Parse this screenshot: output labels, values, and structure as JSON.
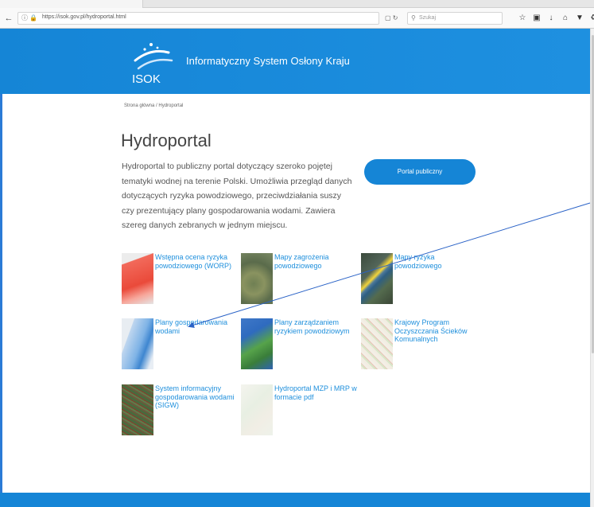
{
  "browser": {
    "url": "https://isok.gov.pl/hydroportal.html",
    "search_placeholder": "Szukaj"
  },
  "header": {
    "logo_text": "ISOK",
    "site_name": "Informatyczny System Osłony Kraju"
  },
  "breadcrumb": {
    "home": "Strona główna",
    "separator": " / ",
    "current": "Hydroportal"
  },
  "page": {
    "title": "Hydroportal",
    "description": "Hydroportal to publiczny portal dotyczący szeroko pojętej tematyki wodnej na terenie Polski. Umożliwia przegląd danych dotyczących ryzyka powodziowego, przeciwdziałania suszy czy prezentujący plany gospodarowania wodami. Zawiera szereg danych zebranych w jednym miejscu.",
    "portal_button": "Portal publiczny"
  },
  "tiles": [
    {
      "label": "Wstępna ocena ryzyka powodziowego (WORP)",
      "thumb": "flood-risk-map-thumbnail"
    },
    {
      "label": "Mapy zagrożenia powodziowego",
      "thumb": "flood-hazard-map-thumbnail"
    },
    {
      "label": "Mapy ryzyka powodziowego",
      "thumb": "flood-risk-aerial-thumbnail"
    },
    {
      "label": "Plany gospodarowania wodami",
      "thumb": "water-management-map-thumbnail"
    },
    {
      "label": "Plany zarządzaniem ryzykiem powodziowym",
      "thumb": "flood-management-map-thumbnail"
    },
    {
      "label": "Krajowy Program Oczyszczania Ścieków Komunalnych",
      "thumb": "sewage-program-map-thumbnail"
    },
    {
      "label": "System informacyjny gospodarowania wodami (SIGW)",
      "thumb": "water-info-system-thumbnail"
    },
    {
      "label": "Hydroportal MZP i MRP w formacie pdf",
      "thumb": "pdf-maps-thumbnail"
    }
  ],
  "colors": {
    "brand_blue": "#1585d6",
    "link_blue": "#1e8fdc",
    "annotation_arrow": "#2b63c7"
  }
}
